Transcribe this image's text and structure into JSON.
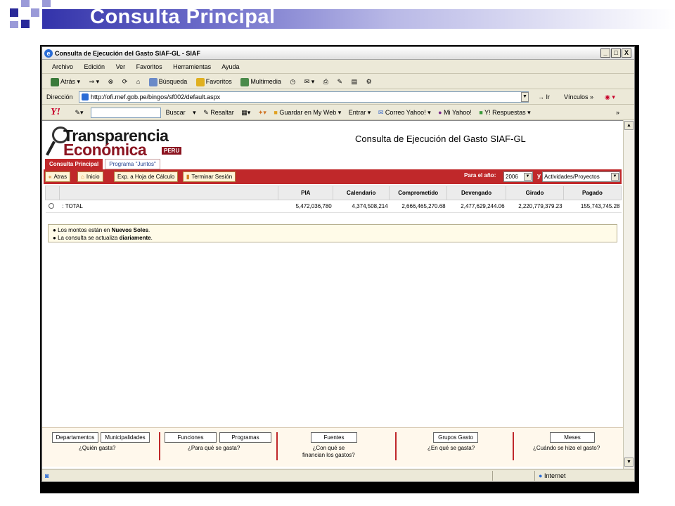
{
  "slide": {
    "title": "Consulta Principal"
  },
  "browser": {
    "window_title": "Consulta de Ejecución del Gasto SIAF-GL - SIAF",
    "window_buttons": [
      "_",
      "□",
      "X"
    ],
    "menu": [
      "Archivo",
      "Edición",
      "Ver",
      "Favoritos",
      "Herramientas",
      "Ayuda"
    ],
    "toolbar": {
      "back": "Atrás",
      "search": "Búsqueda",
      "favorites": "Favoritos",
      "media": "Multimedia"
    },
    "address": {
      "label": "Dirección",
      "url": "http://ofi.mef.gob.pe/bingos/sf002/default.aspx",
      "go": "Ir",
      "links": "Vínculos"
    },
    "yahoo": {
      "logo": "Y!",
      "buscar": "Buscar",
      "resaltar": "Resaltar",
      "guardar": "Guardar en My Web",
      "entrar": "Entrar",
      "correo": "Correo Yahoo!",
      "mi_yahoo": "Mi Yahoo!",
      "respuestas": "Y! Respuestas"
    },
    "status": {
      "zone": "Internet"
    }
  },
  "page": {
    "logo_line1": "Transparencia",
    "logo_line2": "Económica",
    "logo_country": "PERU",
    "heading": "Consulta de Ejecución del Gasto SIAF-GL",
    "tabs": [
      {
        "label": "Consulta Principal",
        "active": true
      },
      {
        "label": "Programa \"Juntos\"",
        "active": false
      }
    ],
    "actions": {
      "back": "Atras",
      "home": "Inicio",
      "export": "Exp. a Hoja de Cálculo",
      "logout": "Terminar Sesión"
    },
    "year_label": "Para el año:",
    "year_value": "2006",
    "y_text": "y",
    "view_value": "Actividades/Proyectos",
    "table": {
      "headers": [
        "PIA",
        "Calendario",
        "Comprometido",
        "Devengado",
        "Girado",
        "Pagado"
      ],
      "rows": [
        {
          "label": ": TOTAL",
          "values": [
            "5,472,036,780",
            "4,374,508,214",
            "2,666,465,270.68",
            "2,477,629,244.06",
            "2,220,779,379.23",
            "155,743,745.28"
          ]
        }
      ]
    },
    "notes": {
      "n1_pre": "Los montos están en ",
      "n1_bold": "Nuevos Soles",
      "n1_post": ".",
      "n2_pre": "La consulta se actualiza ",
      "n2_bold": "diariamente",
      "n2_post": "."
    },
    "bottom_nav": {
      "departamentos": "Departamentos",
      "municipalidades": "Municipalidades",
      "q1": "¿Quién gasta?",
      "funciones": "Funciones",
      "programas": "Programas",
      "q2": "¿Para qué se gasta?",
      "fuentes": "Fuentes",
      "q3a": "¿Con qué se",
      "q3b": "financian los gastos?",
      "grupos": "Grupos Gasto",
      "q4": "¿En qué se gasta?",
      "meses": "Meses",
      "q5": "¿Cuándo se hizo el gasto?"
    }
  }
}
